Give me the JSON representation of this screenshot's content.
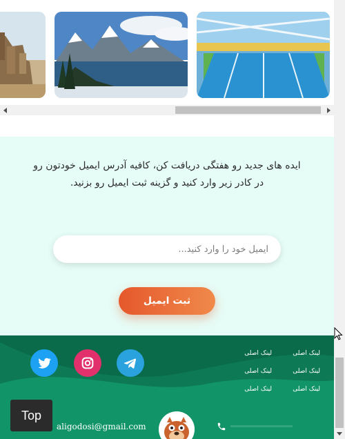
{
  "gallery": {
    "images": [
      "castle-photo",
      "mountain-lake-photo",
      "indoor-pool-photo"
    ]
  },
  "newsletter": {
    "text": "ایده های جدید رو هفتگی دریافت کن، کافیه آدرس ایمیل خودتون رو در کادر زیر وارد کنید و گزینه ثبت ایمیل رو بزنید.",
    "email_placeholder": "ایمیل خود را وارد کنید...",
    "submit_label": "ثبت ایمیل"
  },
  "footer": {
    "links": [
      "لینک اصلی",
      "لینک اصلی",
      "لینک اصلی",
      "لینک اصلی",
      "لینک اصلی",
      "لینک اصلی"
    ],
    "social": [
      "twitter-icon",
      "instagram-icon",
      "telegram-icon"
    ],
    "email": "aligodosi@gmail.com"
  },
  "top_button": {
    "label": "Top"
  },
  "colors": {
    "newsletter_bg": "#e6fcf6",
    "button_accent": "#e5582c",
    "footer_bg": "#0e7a55",
    "twitter": "#1da1f2",
    "instagram": "#e1306c",
    "telegram": "#2aa2de"
  }
}
